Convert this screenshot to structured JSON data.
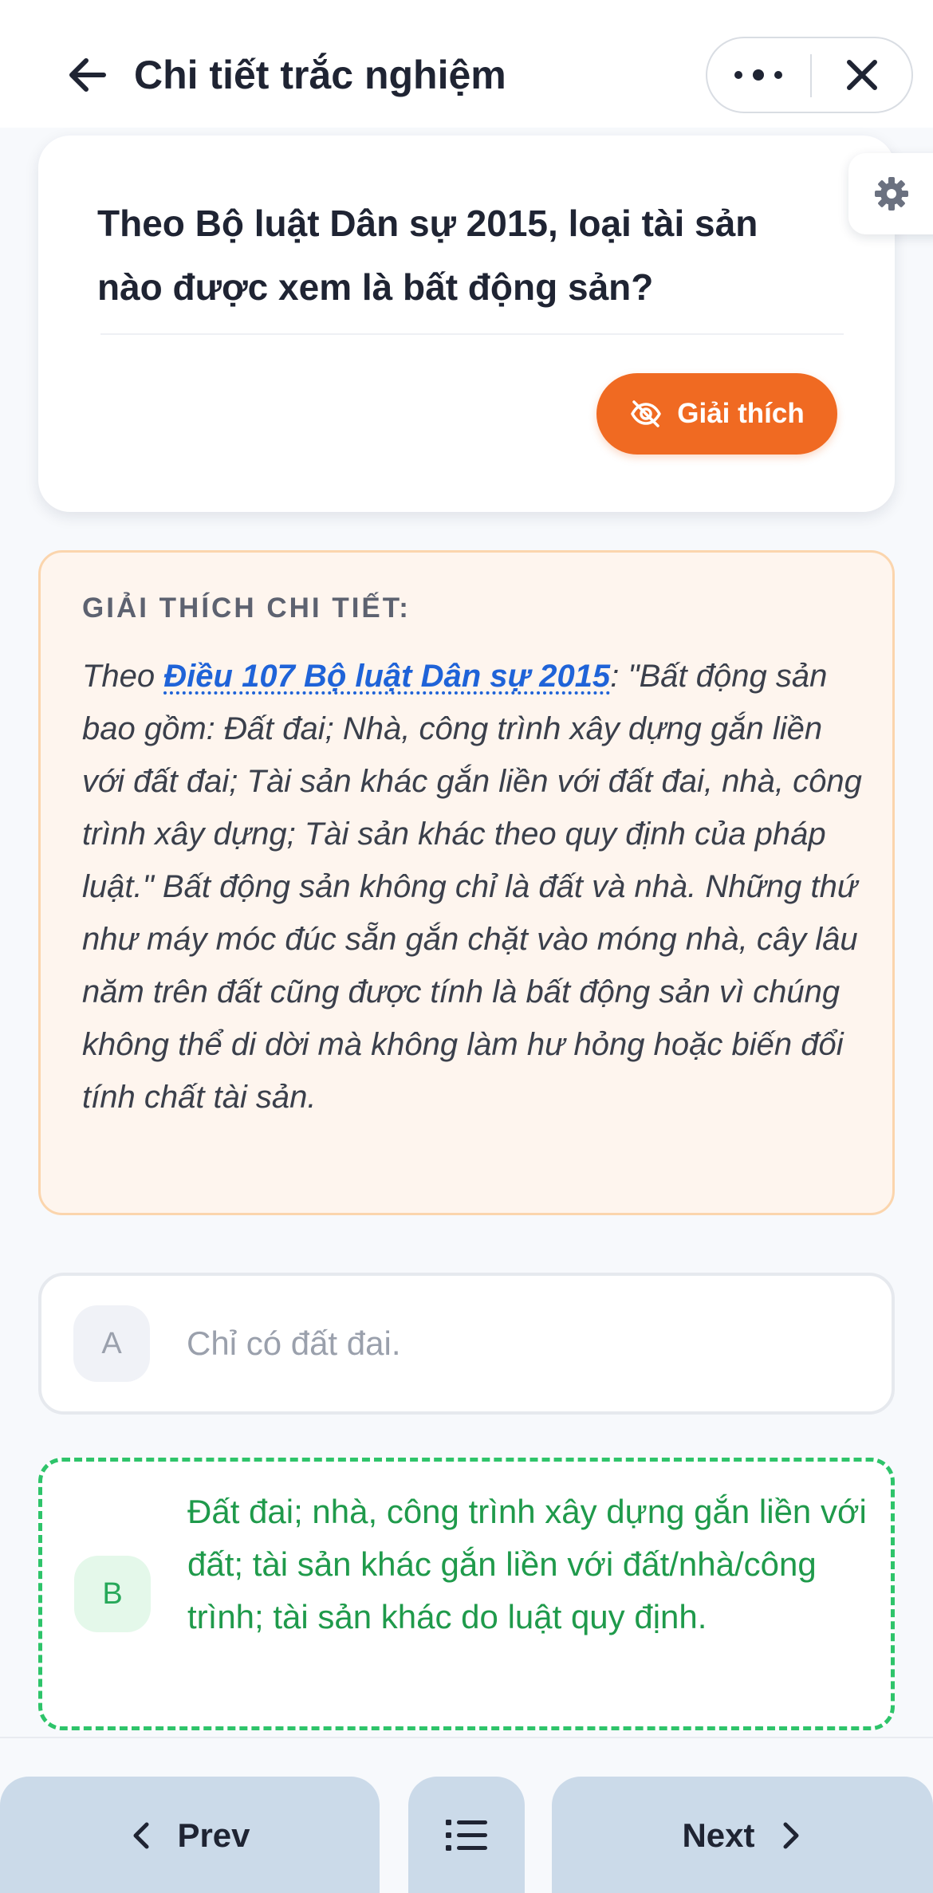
{
  "header": {
    "title": "Chi tiết trắc nghiệm",
    "back_icon": "arrow-left-icon",
    "more_icon": "more-dots-icon",
    "close_icon": "close-icon"
  },
  "question": {
    "text": "Theo Bộ luật Dân sự 2015, loại tài sản nào được xem là bất động sản?",
    "explain_button_label": "Giải thích",
    "explain_button_icon": "eye-off-icon"
  },
  "settings_icon": "gear-icon",
  "explanation": {
    "heading": "GIẢI THÍCH CHI TIẾT:",
    "prefix": "Theo ",
    "link_text": "Điều 107 Bộ luật Dân sự 2015",
    "body": ": \"Bất động sản bao gồm: Đất đai; Nhà, công trình xây dựng gắn liền với đất đai; Tài sản khác gắn liền với đất đai, nhà, công trình xây dựng; Tài sản khác theo quy định của pháp luật.\" Bất động sản không chỉ là đất và nhà. Những thứ như máy móc đúc sẵn gắn chặt vào móng nhà, cây lâu năm trên đất cũng được tính là bất động sản vì chúng không thể di dời mà không làm hư hỏng hoặc biến đổi tính chất tài sản."
  },
  "options": [
    {
      "letter": "A",
      "text": "Chỉ có đất đai."
    },
    {
      "letter": "B",
      "text": "Đất đai; nhà, công trình xây dựng gắn liền với đất; tài sản khác gắn liền với đất/nhà/công trình; tài sản khác do luật quy định."
    }
  ],
  "bottom_nav": {
    "prev_label": "Prev",
    "next_label": "Next",
    "list_icon": "list-icon"
  },
  "colors": {
    "accent_orange": "#f06a22",
    "correct_green": "#2ec46a",
    "link_blue": "#1f63d8",
    "nav_button": "#cbdae9"
  }
}
